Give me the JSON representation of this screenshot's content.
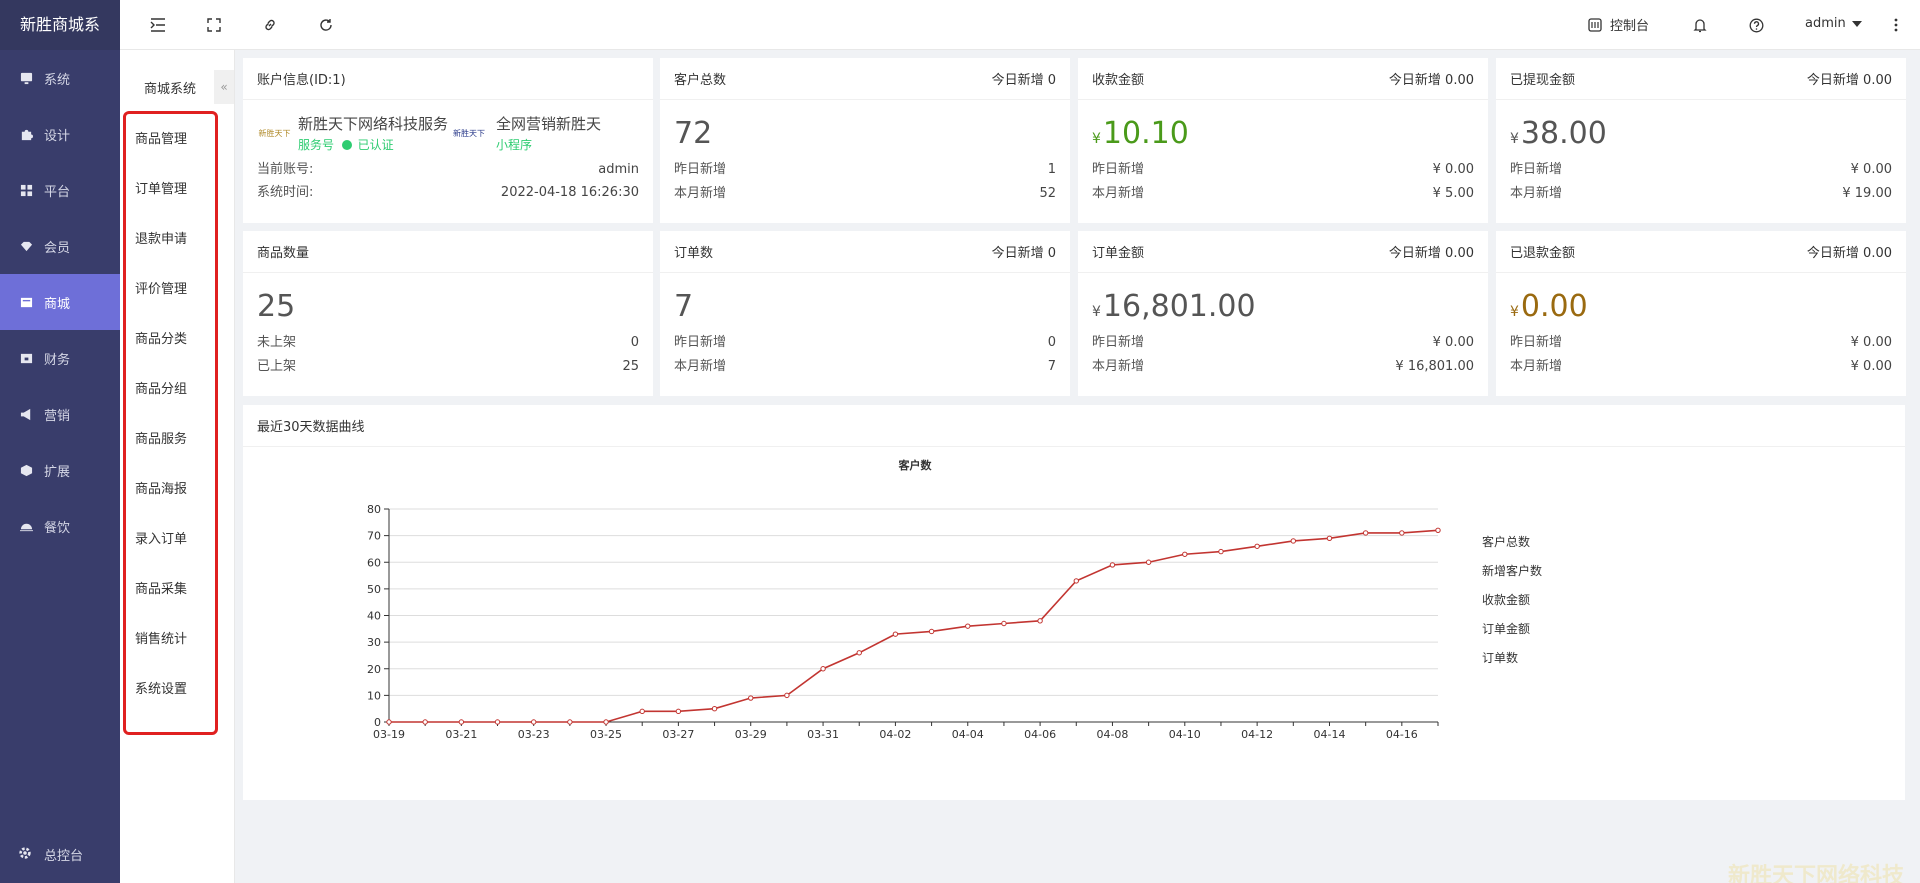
{
  "app": {
    "title": "新胜商城系"
  },
  "sidebar": {
    "items": [
      {
        "label": "系统",
        "icon": "monitor-icon"
      },
      {
        "label": "设计",
        "icon": "puzzle-icon"
      },
      {
        "label": "平台",
        "icon": "grid-icon"
      },
      {
        "label": "会员",
        "icon": "diamond-icon"
      },
      {
        "label": "商城",
        "icon": "shop-icon",
        "active": true
      },
      {
        "label": "财务",
        "icon": "wallet-icon"
      },
      {
        "label": "营销",
        "icon": "megaphone-icon"
      },
      {
        "label": "扩展",
        "icon": "cube-icon"
      },
      {
        "label": "餐饮",
        "icon": "dish-icon"
      }
    ],
    "bottom": {
      "label": "总控台",
      "icon": "gear-icon"
    }
  },
  "subnav": {
    "title": "商城系统",
    "collapse_label": "«",
    "items": [
      "商品管理",
      "订单管理",
      "退款申请",
      "评价管理",
      "商品分类",
      "商品分组",
      "商品服务",
      "商品海报",
      "录入订单",
      "商品采集",
      "销售统计",
      "系统设置"
    ]
  },
  "topbar": {
    "console_label": "控制台",
    "user_label": "admin"
  },
  "account": {
    "title": "账户信息(ID:1)",
    "brands": [
      {
        "name": "新胜天下网络科技服务",
        "tag": "服务号",
        "tag2": "已认证",
        "logo_text": "新胜天下"
      },
      {
        "name": "全网营销新胜天",
        "tag": "小程序",
        "logo_text": "新胜天下"
      }
    ],
    "rows": [
      {
        "label": "当前账号:",
        "value": "admin"
      },
      {
        "label": "系统时间:",
        "value": "2022-04-18 16:26:30"
      }
    ]
  },
  "stats": [
    {
      "title": "客户总数",
      "today": "今日新增 0",
      "value": "72",
      "yen": "",
      "color": "#555555",
      "rows": [
        {
          "label": "昨日新增",
          "value": "1"
        },
        {
          "label": "本月新增",
          "value": "52"
        }
      ]
    },
    {
      "title": "收款金额",
      "today": "今日新增 0.00",
      "value": "10.10",
      "yen": "¥",
      "color": "#4a9a1a",
      "rows": [
        {
          "label": "昨日新增",
          "value": "¥ 0.00"
        },
        {
          "label": "本月新增",
          "value": "¥ 5.00"
        }
      ]
    },
    {
      "title": "已提现金额",
      "today": "今日新增 0.00",
      "value": "38.00",
      "yen": "¥",
      "color": "#555555",
      "rows": [
        {
          "label": "昨日新增",
          "value": "¥ 0.00"
        },
        {
          "label": "本月新增",
          "value": "¥ 19.00"
        }
      ]
    },
    {
      "title": "商品数量",
      "today": "",
      "value": "25",
      "yen": "",
      "color": "#555555",
      "rows": [
        {
          "label": "未上架",
          "value": "0"
        },
        {
          "label": "已上架",
          "value": "25"
        }
      ]
    },
    {
      "title": "订单数",
      "today": "今日新增 0",
      "value": "7",
      "yen": "",
      "color": "#555555",
      "rows": [
        {
          "label": "昨日新增",
          "value": "0"
        },
        {
          "label": "本月新增",
          "value": "7"
        }
      ]
    },
    {
      "title": "订单金额",
      "today": "今日新增 0.00",
      "value": "16,801.00",
      "yen": "¥",
      "color": "#555555",
      "rows": [
        {
          "label": "昨日新增",
          "value": "¥ 0.00"
        },
        {
          "label": "本月新增",
          "value": "¥ 16,801.00"
        }
      ]
    },
    {
      "title": "已退款金额",
      "today": "今日新增 0.00",
      "value": "0.00",
      "yen": "¥",
      "color": "#9a6a10",
      "rows": [
        {
          "label": "昨日新增",
          "value": "¥ 0.00"
        },
        {
          "label": "本月新增",
          "value": "¥ 0.00"
        }
      ]
    }
  ],
  "chart_card": {
    "title": "最近30天数据曲线"
  },
  "watermark": "新胜天下网络科技",
  "chart_data": {
    "type": "line",
    "title": "客户数",
    "x": [
      "03-19",
      "03-20",
      "03-21",
      "03-22",
      "03-23",
      "03-24",
      "03-25",
      "03-26",
      "03-27",
      "03-28",
      "03-29",
      "03-30",
      "03-31",
      "04-01",
      "04-02",
      "04-03",
      "04-04",
      "04-05",
      "04-06",
      "04-07",
      "04-08",
      "04-09",
      "04-10",
      "04-11",
      "04-12",
      "04-13",
      "04-14",
      "04-15",
      "04-16",
      "04-17"
    ],
    "xtick_labels": [
      "03-19",
      "03-21",
      "03-23",
      "03-25",
      "03-27",
      "03-29",
      "03-31",
      "04-02",
      "04-04",
      "04-06",
      "04-08",
      "04-10",
      "04-12",
      "04-14",
      "04-16"
    ],
    "series": [
      {
        "name": "客户总数",
        "color": "#c23531",
        "values": [
          0,
          0,
          0,
          0,
          0,
          0,
          0,
          4,
          4,
          5,
          9,
          10,
          20,
          26,
          33,
          34,
          36,
          37,
          38,
          53,
          59,
          60,
          63,
          64,
          66,
          68,
          69,
          71,
          71,
          72
        ]
      }
    ],
    "legend": [
      "客户总数",
      "新增客户数",
      "收款金额",
      "订单金额",
      "订单数"
    ],
    "ylim": [
      0,
      80
    ],
    "yticks": [
      0,
      10,
      20,
      30,
      40,
      50,
      60,
      70,
      80
    ],
    "grid": true,
    "legend_position": "right"
  }
}
